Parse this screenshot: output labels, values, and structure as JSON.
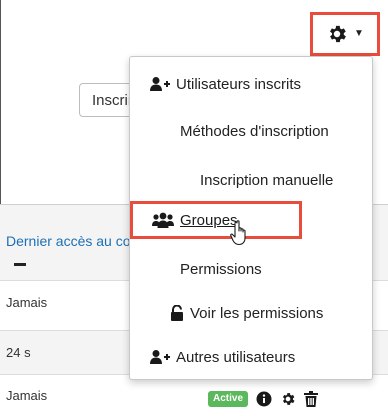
{
  "header": {
    "settings_icon": "gear-icon",
    "caret_icon": "caret-down-icon"
  },
  "toolbar": {
    "enrol_button_label": "Inscrire des utilisateurs"
  },
  "table": {
    "column_header": "Dernier accès au cours",
    "rows": [
      {
        "last_access": "Jamais"
      },
      {
        "last_access": "24 s"
      },
      {
        "last_access": "Jamais",
        "status": "Active"
      }
    ]
  },
  "dropdown": {
    "items": [
      {
        "label": "Utilisateurs inscrits",
        "icon": "user-plus-icon"
      },
      {
        "label": "Méthodes d'inscription"
      },
      {
        "label": "Inscription manuelle"
      },
      {
        "label": "Groupes",
        "icon": "users-icon"
      },
      {
        "label": "Permissions"
      },
      {
        "label": "Voir les permissions",
        "icon": "unlock-icon"
      },
      {
        "label": "Autres utilisateurs",
        "icon": "user-plus-icon"
      }
    ]
  },
  "colors": {
    "highlight_border": "#e74c3c",
    "link": "#1d6fb5",
    "active_badge": "#5cb85c"
  }
}
